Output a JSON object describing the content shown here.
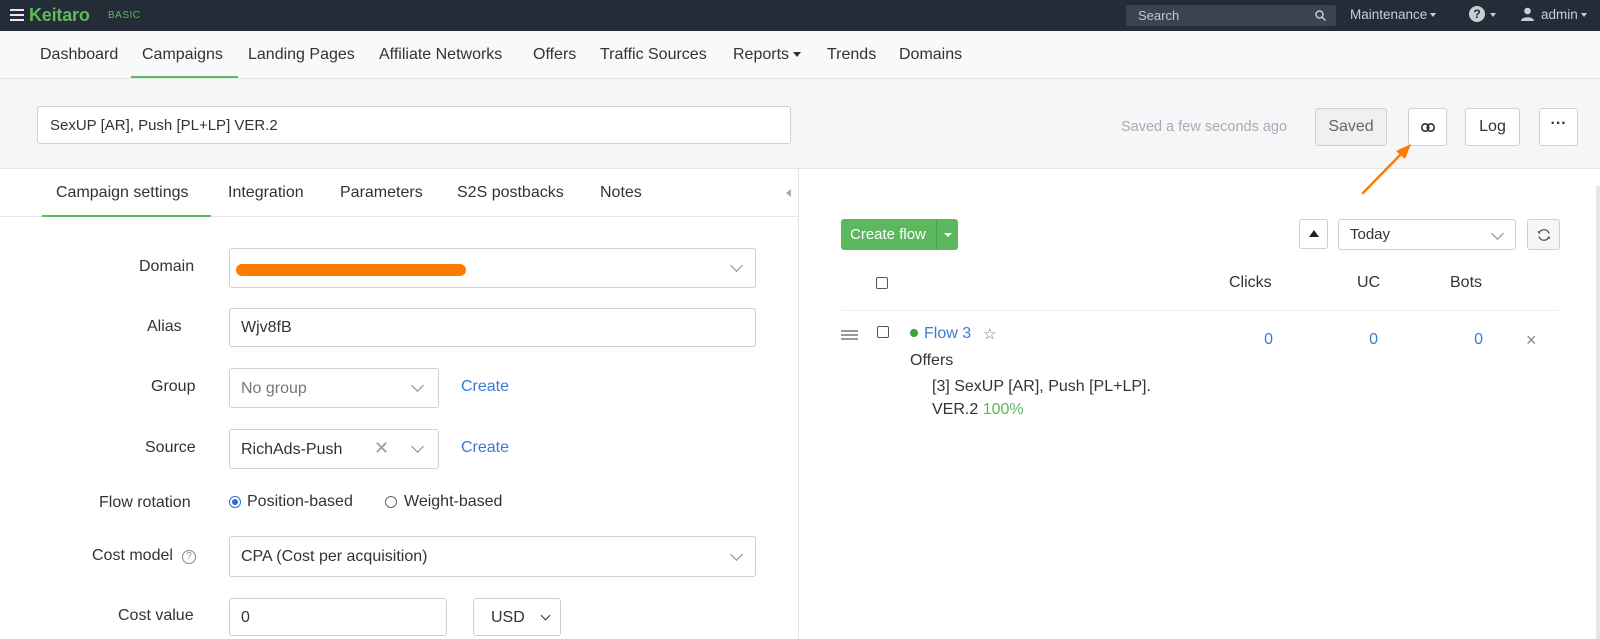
{
  "topbar": {
    "logo": "Keitaro",
    "tier": "BASIC",
    "search_placeholder": "Search",
    "maintenance": "Maintenance",
    "help": "?",
    "user": "admin"
  },
  "nav": {
    "items": [
      "Dashboard",
      "Campaigns",
      "Landing Pages",
      "Affiliate Networks",
      "Offers",
      "Traffic Sources",
      "Reports",
      "Trends",
      "Domains"
    ],
    "active": "Campaigns"
  },
  "campaign": {
    "name": "SexUP [AR], Push [PL+LP] VER.2",
    "saved_status": "Saved a few seconds ago",
    "saved_button": "Saved",
    "log_button": "Log",
    "more_button": "···"
  },
  "tabs": {
    "items": [
      "Campaign settings",
      "Integration",
      "Parameters",
      "S2S postbacks",
      "Notes"
    ],
    "active": "Campaign settings"
  },
  "form": {
    "domain_label": "Domain",
    "alias_label": "Alias",
    "alias_value": "Wjv8fB",
    "group_label": "Group",
    "group_value": "No group",
    "group_create": "Create",
    "source_label": "Source",
    "source_value": "RichAds-Push",
    "source_create": "Create",
    "rotation_label": "Flow rotation",
    "rotation_options": [
      "Position-based",
      "Weight-based"
    ],
    "rotation_selected": "Position-based",
    "cost_model_label": "Cost model",
    "cost_model_value": "CPA (Cost per acquisition)",
    "cost_value_label": "Cost value",
    "cost_value": "0",
    "currency": "USD"
  },
  "flows": {
    "create_button": "Create flow",
    "period": "Today",
    "columns": [
      "Clicks",
      "UC",
      "Bots"
    ],
    "rows": [
      {
        "name": "Flow 3",
        "offers_label": "Offers",
        "offer_line1": "[3] SexUP [AR], Push [PL+LP].",
        "offer_line2": "VER.2",
        "offer_pct": "100%",
        "clicks": "0",
        "uc": "0",
        "bots": "0"
      }
    ]
  },
  "colors": {
    "topbar": "#232c37",
    "brand_green": "#5fba5c",
    "link_blue": "#3a7bd5",
    "annotation_orange": "#ff7a00"
  }
}
